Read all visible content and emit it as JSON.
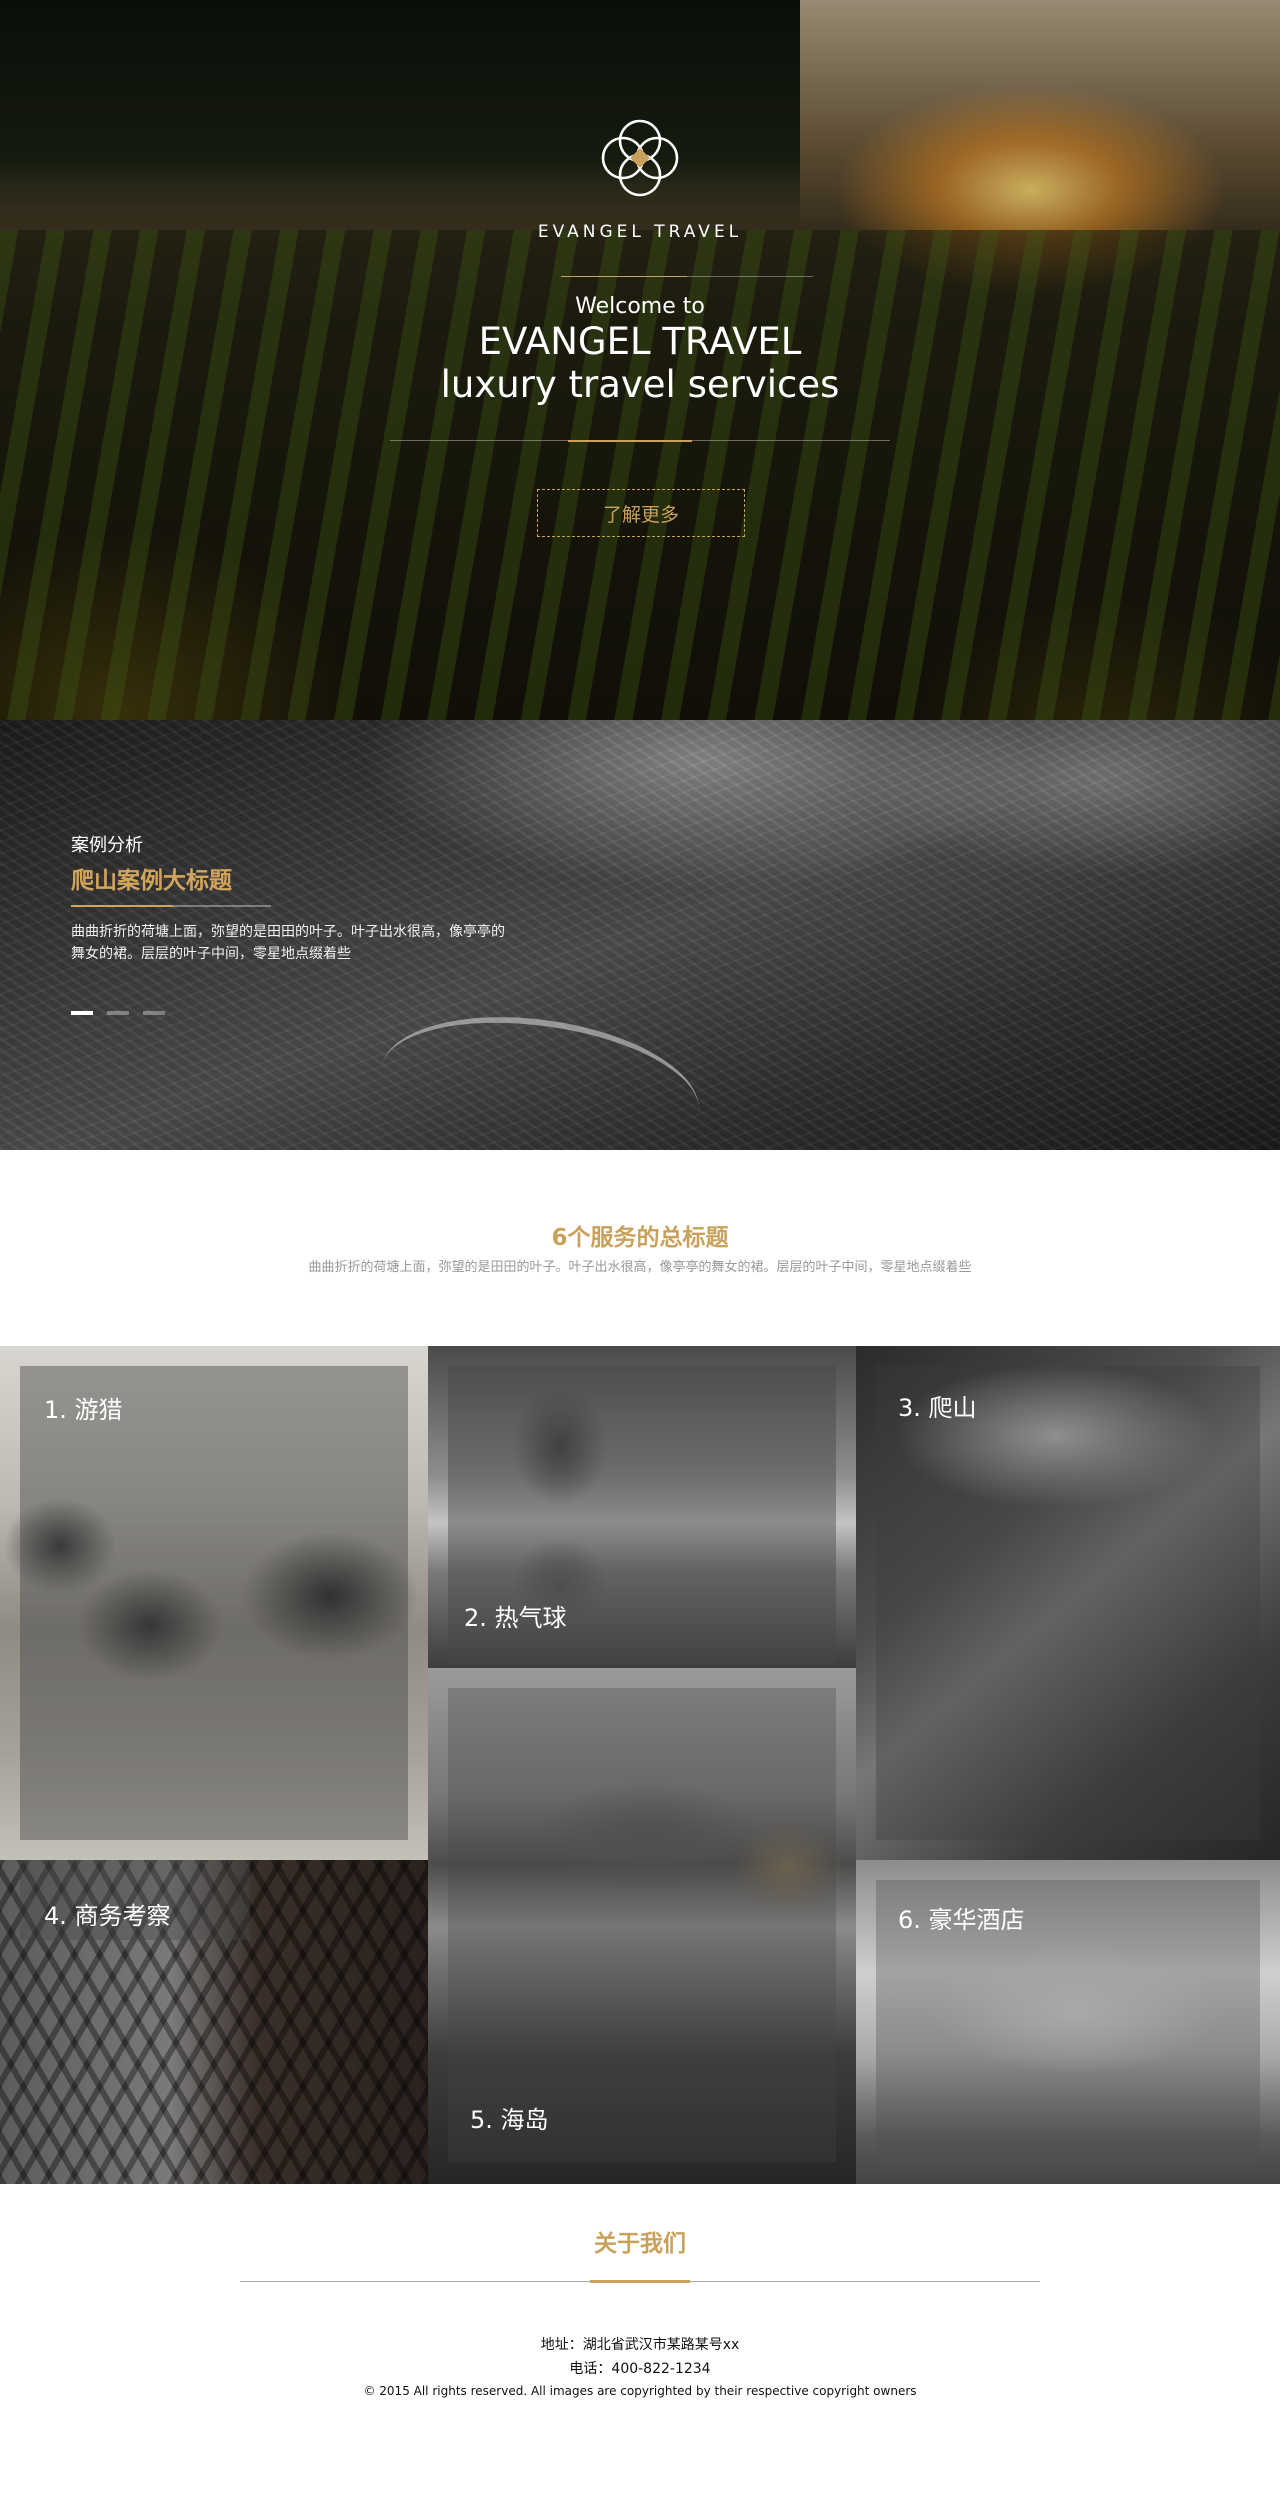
{
  "hero": {
    "brand": "EVANGEL TRAVEL",
    "welcome": "Welcome to",
    "title_line1": "EVANGEL TRAVEL",
    "title_line2": "luxury travel services",
    "cta_label": "了解更多"
  },
  "case_study": {
    "label": "案例分析",
    "title": "爬山案例大标题",
    "body": "曲曲折折的荷塘上面，弥望的是田田的叶子。叶子出水很高，像亭亭的舞女的裙。层层的叶子中间，零星地点缀着些",
    "slides": 3,
    "active_slide": 1
  },
  "services": {
    "title": "6个服务的总标题",
    "subtitle": "曲曲折折的荷塘上面，弥望的是田田的叶子。叶子出水很高，像亭亭的舞女的裙。层层的叶子中间，零星地点缀着些",
    "items": [
      {
        "label": "1. 游猎"
      },
      {
        "label": "2. 热气球"
      },
      {
        "label": "3. 爬山"
      },
      {
        "label": "4. 商务考察"
      },
      {
        "label": "5. 海岛"
      },
      {
        "label": "6. 豪华酒店"
      }
    ]
  },
  "about": {
    "title": "关于我们",
    "address": "地址：湖北省武汉市某路某号xx",
    "phone": "电话：400-822-1234",
    "copyright": "© 2015 All rights reserved. All images are copyrighted by their respective copyright owners"
  },
  "colors": {
    "accent_gold": "#c9a15a",
    "case_title_gold": "#d3a55c",
    "subtitle_grey": "#999999"
  },
  "icons": {
    "logo": "interlocking-circles-logo-icon"
  }
}
